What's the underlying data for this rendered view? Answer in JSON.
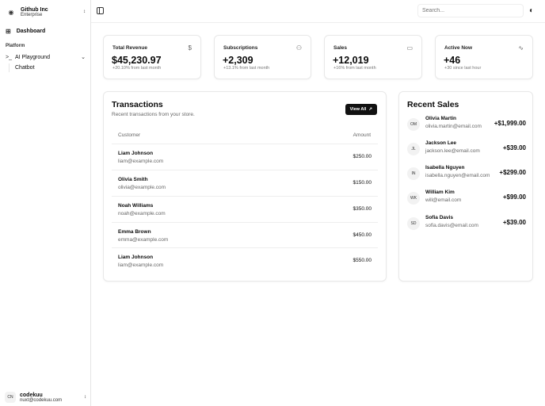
{
  "team": {
    "name": "Github Inc",
    "plan": "Enterprise"
  },
  "nav": {
    "dashboard": "Dashboard",
    "group": "Platform",
    "ai_playground": "AI Playground",
    "chatbot": "Chatbot"
  },
  "user": {
    "initials": "CN",
    "name": "codekuu",
    "email": "nuxt@codekuu.com"
  },
  "header": {
    "search_placeholder": "Search..."
  },
  "stats": [
    {
      "label": "Total Revenue",
      "value": "$45,230.97",
      "sub": "+20.10% from last month",
      "icon": "dollar-icon"
    },
    {
      "label": "Subscriptions",
      "value": "+2,309",
      "sub": "+13.1% from last month",
      "icon": "users-icon"
    },
    {
      "label": "Sales",
      "value": "+12,019",
      "sub": "+16% from last month",
      "icon": "credit-card-icon"
    },
    {
      "label": "Active Now",
      "value": "+46",
      "sub": "+30 since last hour",
      "icon": "activity-icon"
    }
  ],
  "transactions": {
    "title": "Transactions",
    "subtitle": "Recent transactions from your store.",
    "view_all": "View All",
    "col_customer": "Customer",
    "col_amount": "Amount",
    "rows": [
      {
        "name": "Liam Johnson",
        "email": "liam@example.com",
        "amount": "$250.00"
      },
      {
        "name": "Olivia Smith",
        "email": "olivia@example.com",
        "amount": "$150.00"
      },
      {
        "name": "Noah Williams",
        "email": "noah@example.com",
        "amount": "$350.00"
      },
      {
        "name": "Emma Brown",
        "email": "emma@example.com",
        "amount": "$450.00"
      },
      {
        "name": "Liam Johnson",
        "email": "liam@example.com",
        "amount": "$550.00"
      }
    ]
  },
  "recent_sales": {
    "title": "Recent Sales",
    "items": [
      {
        "initials": "OM",
        "name": "Olivia Martin",
        "email": "olivia.martin@email.com",
        "amount": "+$1,999.00"
      },
      {
        "initials": "JL",
        "name": "Jackson Lee",
        "email": "jackson.lee@email.com",
        "amount": "+$39.00"
      },
      {
        "initials": "IN",
        "name": "Isabella Nguyen",
        "email": "isabella.nguyen@email.com",
        "amount": "+$299.00"
      },
      {
        "initials": "WK",
        "name": "William Kim",
        "email": "will@email.com",
        "amount": "+$99.00"
      },
      {
        "initials": "SD",
        "name": "Sofia Davis",
        "email": "sofia.davis@email.com",
        "amount": "+$39.00"
      }
    ]
  }
}
